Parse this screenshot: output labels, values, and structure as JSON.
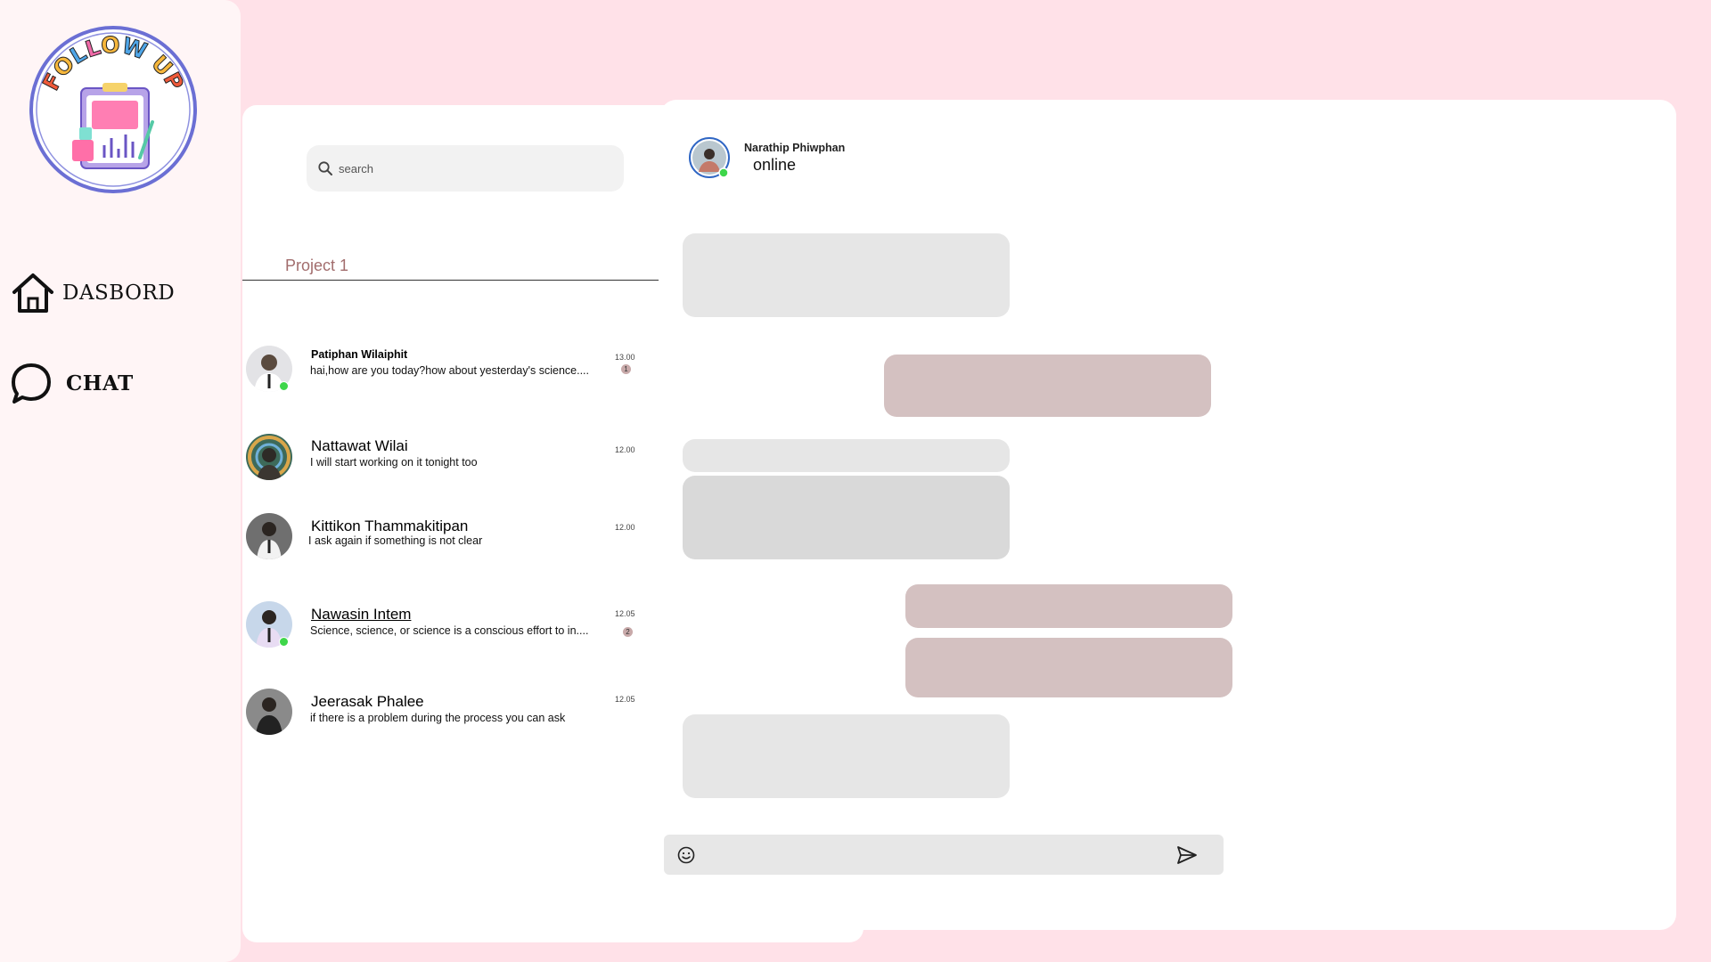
{
  "logo": {
    "text": "FOLLOW UP",
    "icon": "clipboard-chart-logo"
  },
  "sidebar": {
    "items": [
      {
        "label": "DASBORD",
        "icon": "home-icon"
      },
      {
        "label": "CHAT",
        "icon": "chat-bubble-icon"
      }
    ]
  },
  "search": {
    "placeholder": "search",
    "icon": "search-icon"
  },
  "project_tab": {
    "label": "Project 1"
  },
  "contacts": [
    {
      "name": "Patiphan Wilaiphit",
      "message": "hai,how are you today?how about yesterday's science....",
      "time": "13.00",
      "badge": "1",
      "online": true
    },
    {
      "name": "Nattawat Wilai",
      "message": "I will start working on it tonight too",
      "time": "12.00",
      "online": false
    },
    {
      "name": "Kittikon Thammakitipan",
      "message": "I ask again if something is not clear",
      "time": "12.00",
      "online": false
    },
    {
      "name": "Nawasin Intem",
      "message": "Science, science, or science is a conscious effort to in....",
      "time": "12.05",
      "badge": "2",
      "online": true
    },
    {
      "name": "Jeerasak Phalee",
      "message": "if there is a problem during the process you can ask",
      "time": "12.05",
      "online": false
    }
  ],
  "chat_header": {
    "name": "Narathip Phiwphan",
    "status": "online"
  },
  "composer": {
    "placeholder": "",
    "emoji_icon": "smiley-icon",
    "send_icon": "send-icon"
  },
  "colors": {
    "background": "#ffe1e8",
    "sidebar": "#fff5f6",
    "incoming_bubble": "#e6e6e6",
    "outgoing_bubble": "#d4c1c1",
    "online": "#3ed64a",
    "project_tab": "#a26d6d"
  }
}
